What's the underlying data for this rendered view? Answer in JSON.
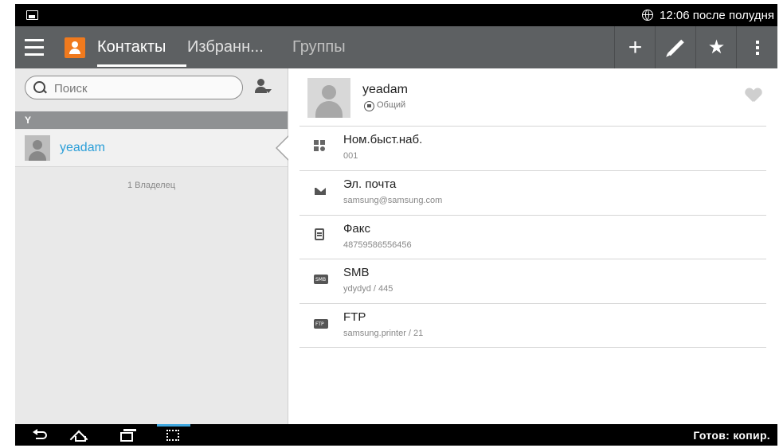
{
  "status_bar": {
    "time": "12:06 после полудня"
  },
  "action_bar": {
    "tabs": [
      {
        "label": "Контакты"
      },
      {
        "label": "Избранн..."
      },
      {
        "label": "Группы"
      }
    ],
    "buttons": {
      "add": "+",
      "favorite": "★"
    }
  },
  "left_panel": {
    "search_placeholder": "Поиск",
    "section_header": "Y",
    "contacts": [
      {
        "name": "yeadam"
      }
    ],
    "owner_count": "1 Владелец"
  },
  "detail": {
    "name": "yeadam",
    "shared_label": "Общий",
    "fields": [
      {
        "label": "Ном.быст.наб.",
        "value": "001",
        "icon": "speed-dial-icon"
      },
      {
        "label": "Эл. почта",
        "value": "samsung@samsung.com",
        "icon": "email-icon"
      },
      {
        "label": "Факс",
        "value": "48759586556456",
        "icon": "fax-icon"
      },
      {
        "label": "SMB",
        "value": "ydydyd / 445",
        "icon": "smb-folder-icon",
        "icon_text": "SMB"
      },
      {
        "label": "FTP",
        "value": "samsung.printer / 21",
        "icon": "ftp-folder-icon",
        "icon_text": "FTP"
      }
    ]
  },
  "bottom_bar": {
    "status": "Готов: копир."
  },
  "colors": {
    "accent": "#2a9ed8",
    "action_bar": "#5d6062",
    "logo": "#f07a1e",
    "highlight": "#3fa8e0"
  }
}
